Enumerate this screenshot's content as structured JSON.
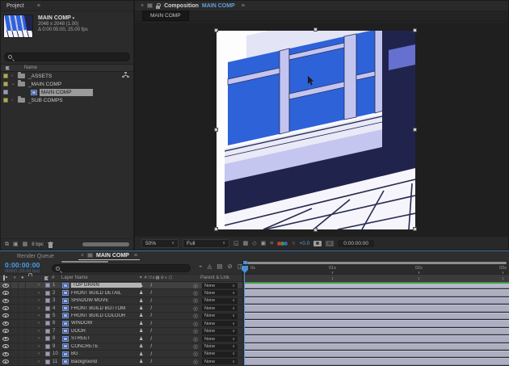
{
  "project_panel": {
    "tab": "Project",
    "comp_info": {
      "name": "MAIN COMP",
      "dimensions": "2048 x 2048 (1.00)",
      "duration": "Δ 0:00:05:00, 25.00 fps"
    },
    "search_placeholder": "",
    "name_column": "Name",
    "items": [
      {
        "label": "_ASSETS",
        "type": "folder"
      },
      {
        "label": "_MAIN COMP",
        "type": "folder"
      },
      {
        "label": "MAIN COMP",
        "type": "composition",
        "selected": true
      },
      {
        "label": "_SUB COMPS",
        "type": "folder"
      }
    ],
    "footer": {
      "bit_depth": "8 bpc"
    }
  },
  "comp_panel": {
    "close": "×",
    "title_prefix": "Composition",
    "title_comp": "MAIN COMP",
    "subtab": "MAIN COMP",
    "toolbar": {
      "zoom": "50%",
      "resolution": "Full",
      "exposure": "+0.0",
      "timecode": "0:00:00:00"
    },
    "icon_names": [
      "region-of-interest-icon",
      "transparency-grid-icon",
      "mask-visibility-icon",
      "roi-icon",
      "rulers-icon",
      "channel-rgb-icon",
      "exposure-icon",
      "snapshot-camera-icon",
      "show-snapshot-icon"
    ]
  },
  "timeline_panel": {
    "tabs": {
      "render_queue": "Render Queue",
      "main_comp": "MAIN COMP"
    },
    "timecode": "0:00:00:00",
    "timecode_sub": "00000 (25.00 fps)",
    "icon_names": [
      "mini-flowchart-icon",
      "shy-icon",
      "frame-blend-icon",
      "motion-blur-icon",
      "graph-editor-icon"
    ],
    "columns": {
      "number": "#",
      "layer_name": "Layer Name",
      "parent": "Parent & Link"
    },
    "switch_header_glyphs": "✦☀\\fx▦⊘◐⬡",
    "ruler_ticks": [
      "0s",
      "01s",
      "02s",
      "03s"
    ],
    "layers": [
      {
        "num": "1",
        "name": "TOP GRAIN",
        "parent": "None",
        "selected": true
      },
      {
        "num": "2",
        "name": "FRONT BUILD DETAIL",
        "parent": "None"
      },
      {
        "num": "3",
        "name": "SHADOW MOVE",
        "parent": "None"
      },
      {
        "num": "4",
        "name": "FRONT BUILD BOTTOM",
        "parent": "None"
      },
      {
        "num": "5",
        "name": "FRONT BUILD COLOUR",
        "parent": "None"
      },
      {
        "num": "6",
        "name": "WINDOW",
        "parent": "None"
      },
      {
        "num": "7",
        "name": "DOOR",
        "parent": "None"
      },
      {
        "num": "8",
        "name": "STREET",
        "parent": "None"
      },
      {
        "num": "9",
        "name": "CONCRETE",
        "parent": "None"
      },
      {
        "num": "10",
        "name": "BG",
        "parent": "None"
      },
      {
        "num": "11",
        "name": "Background",
        "parent": "None"
      }
    ]
  },
  "colors": {
    "accent_blue": "#4a90d8",
    "timecode_blue": "#4c9fe8",
    "label_yellow": "#b9a942",
    "label_lavender": "#9c9cb4",
    "cache_green": "#3f9d42",
    "layer_bar": "#adaec1",
    "glass_blue": "#2e62d8",
    "frame_lavender": "#c3c5f0",
    "dark_navy": "#20244c"
  }
}
